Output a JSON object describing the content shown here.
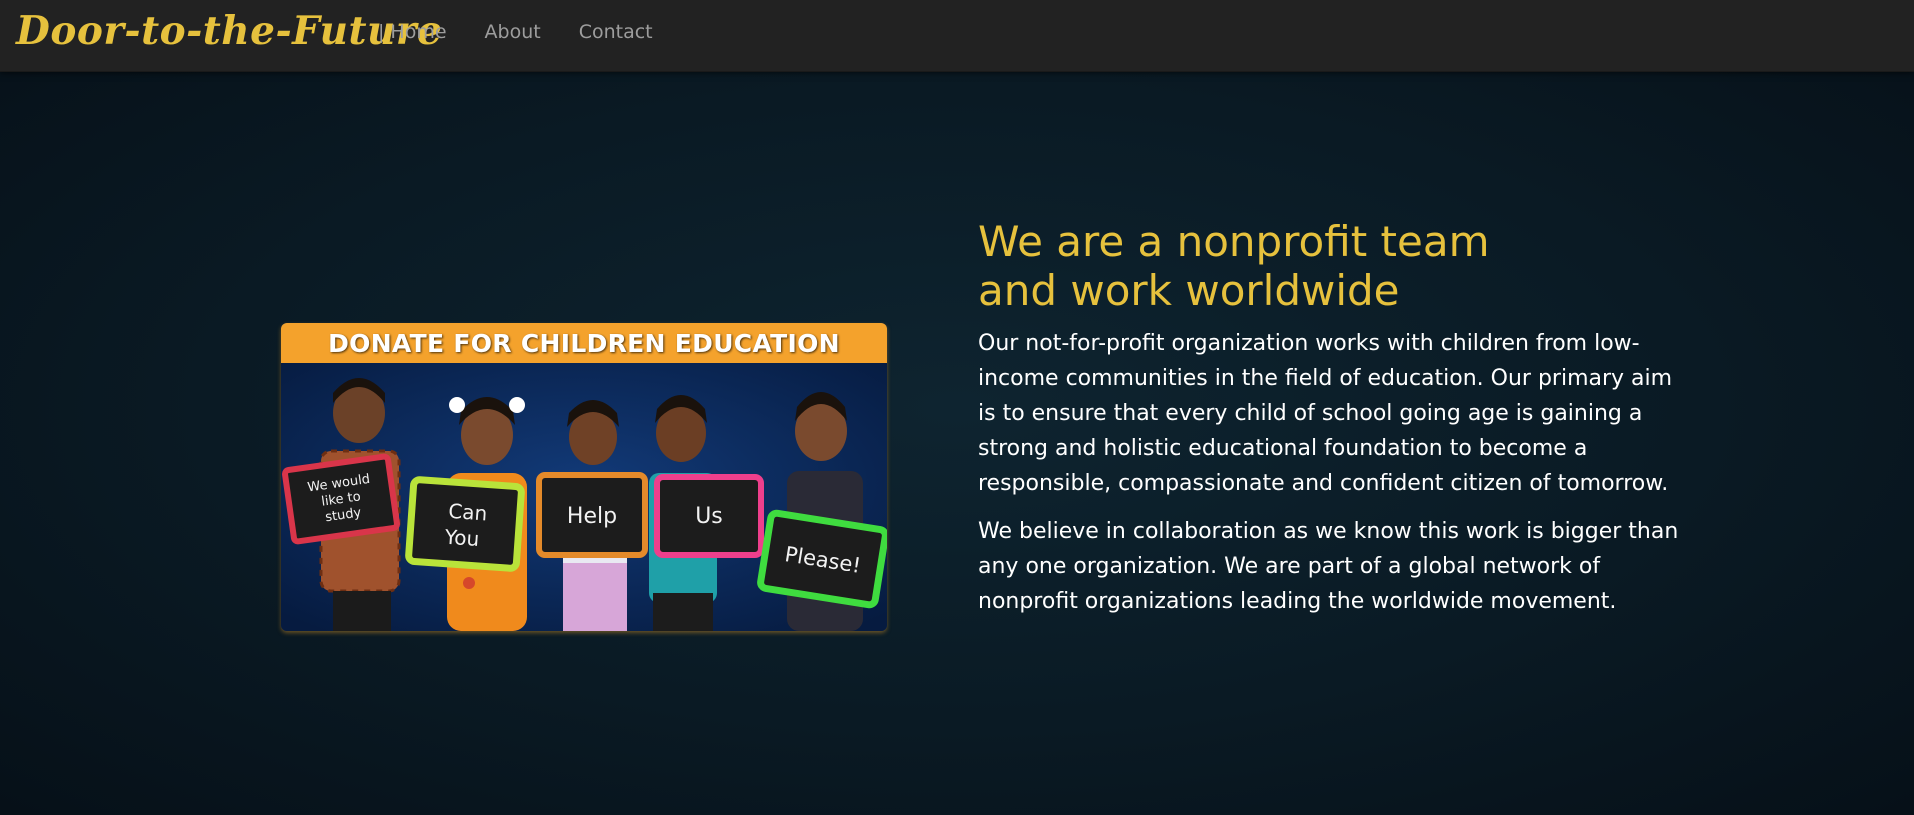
{
  "navbar": {
    "brand": "Door-to-the-Future",
    "separator": "|",
    "links": [
      "Home",
      "About",
      "Contact"
    ]
  },
  "hero_image": {
    "banner_text": "DONATE FOR CHILDREN EDUCATION",
    "signs": [
      "We would like to study",
      "Can You",
      "Help",
      "Us",
      "Please!"
    ],
    "colors": {
      "banner": "#f4a22c",
      "background": "#0a2a5c",
      "sign_red": "#d9354a",
      "sign_green": "#9be23a",
      "sign_orange": "#e48a2a",
      "sign_pink": "#ee3f8c",
      "sign_lime": "#3fdc3f"
    }
  },
  "content": {
    "heading_line1": "We are a nonprofit team",
    "heading_line2": "and work worldwide",
    "paragraph1": "Our not-for-profit organization works with children from low-income communities in the field of education. Our primary aim is to ensure that every child of school going age is gaining a strong and holistic educational foundation to become a responsible, compassionate and confident citizen of tomorrow.",
    "paragraph2": "We believe in collaboration as we know this work is bigger than any one organization. We are part of a global network of nonprofit organizations leading the worldwide movement."
  },
  "theme": {
    "accent": "#e6c13d",
    "navbar_bg": "#222222",
    "nav_text": "#9d9d9d",
    "page_bg": "#0a1a24"
  }
}
